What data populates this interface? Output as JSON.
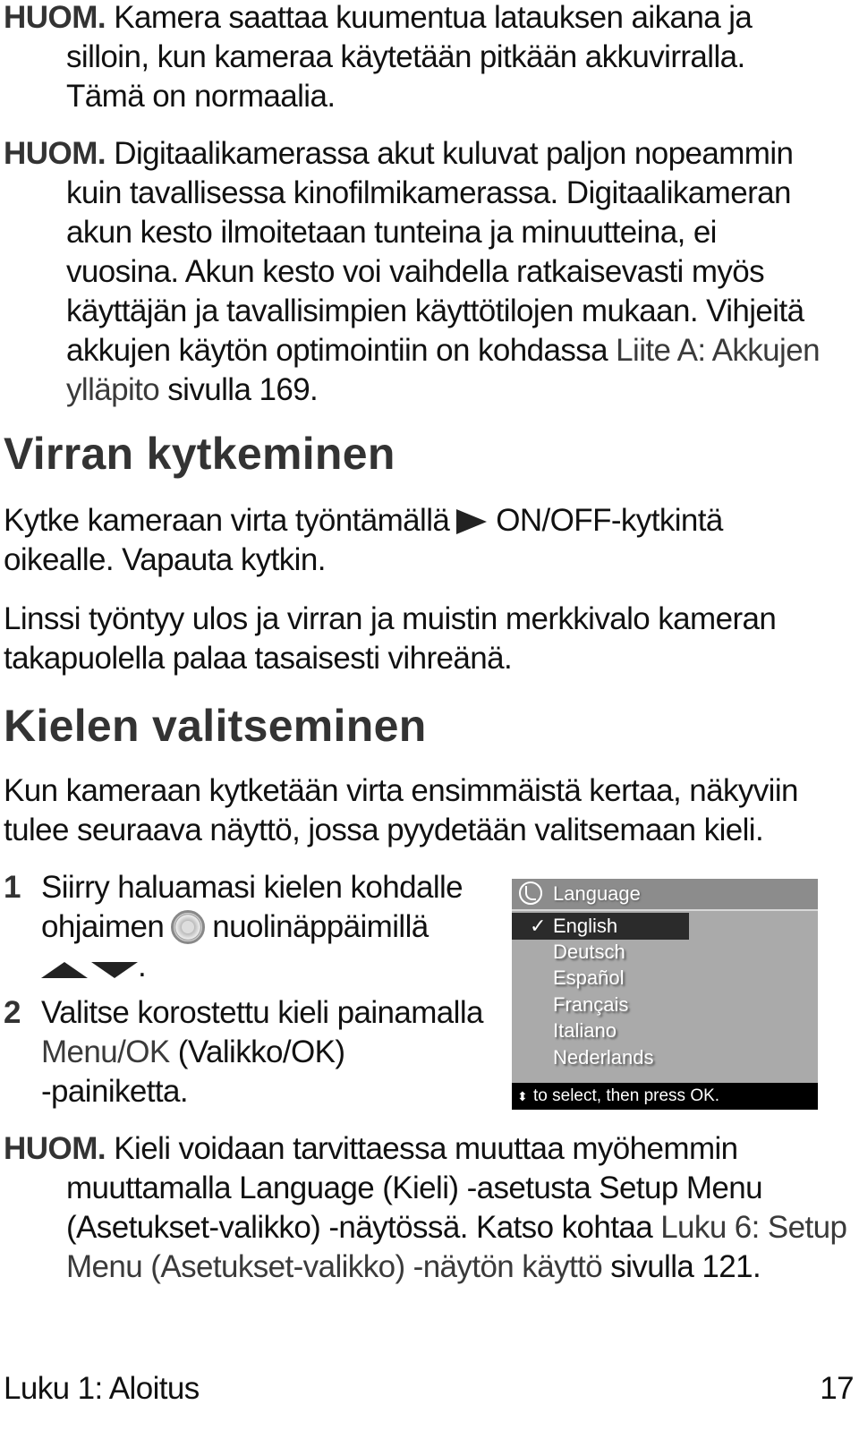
{
  "notes": [
    {
      "label": "HUOM.",
      "lines": [
        "Kamera saattaa kuumentua latauksen aikana ja",
        "silloin, kun kameraa käytetään pitkään akkuvirralla.",
        "Tämä on normaalia."
      ]
    },
    {
      "label": "HUOM.",
      "lines": [
        "Digitaalikamerassa akut kuluvat paljon nopeammin",
        "kuin tavallisessa kinofilmikamerassa. Digitaalikameran",
        "akun kesto ilmoitetaan tunteina ja minuutteina, ei",
        "vuosina. Akun kesto voi vaihdella ratkaisevasti myös",
        "käyttäjän ja tavallisimpien käyttötilojen mukaan. Vihjeitä"
      ],
      "line6_text": "akkujen käytön optimointiin on kohdassa ",
      "line6_xref": "Liite A: Akkujen",
      "line7_xref": "ylläpito",
      "line7_text": " sivulla 169."
    },
    {
      "label": "HUOM.",
      "line1": "Kieli voidaan tarvittaessa muuttaa myöhemmin",
      "line2": "muuttamalla Language (Kieli) -asetusta Setup Menu",
      "line3_text": "(Asetukset-valikko) -näytössä. Katso kohtaa ",
      "line3_xref": "Luku 6: Setup",
      "line4_xref": "Menu (Asetukset-valikko) -näytön käyttö",
      "line4_text": " sivulla 121."
    }
  ],
  "section_power": {
    "heading": "Virran kytkeminen",
    "p1_before_icon": "Kytke kameraan virta työntämällä",
    "p1_icon": "power-switch-icon",
    "p1_after_icon": "ON/OFF-kytkintä",
    "p1_line2": "oikealle. Vapauta kytkin.",
    "p2_line1": "Linssi työntyy ulos ja virran ja muistin merkkivalo kameran",
    "p2_line2": "takapuolella palaa tasaisesti vihreänä."
  },
  "section_language": {
    "heading": "Kielen valitseminen",
    "intro_line1": "Kun kameraan kytketään virta ensimmäistä kertaa, näkyviin",
    "intro_line2": "tulee seuraava näyttö, jossa pyydetään valitsemaan kieli.",
    "steps": [
      {
        "num": "1",
        "line1": "Siirry haluamasi kielen kohdalle",
        "line2_before": "ohjaimen",
        "line2_after": "nuolinäppäimillä",
        "line3_after": "."
      },
      {
        "num": "2",
        "line1": "Valitse korostettu kieli painamalla",
        "line2_xref": "Menu/OK",
        "line2_text": " (Valikko/OK)",
        "line3": "-painiketta."
      }
    ]
  },
  "camera_screen": {
    "title": "Language",
    "title_icon": "globe-icon",
    "selected_mark": "✓",
    "languages": [
      "English",
      "Deutsch",
      "Español",
      "Français",
      "Italiano",
      "Nederlands"
    ],
    "selected": "English",
    "footer_arrows": "⬍",
    "footer_text": "to select, then press OK.",
    "colors": {
      "background": "#aaaaaa",
      "title_bar": "#8c8c8c",
      "highlight": "#2b2b2b",
      "footer": "#000000"
    }
  },
  "footer": {
    "chapter": "Luku 1: Aloitus",
    "page": "17"
  }
}
